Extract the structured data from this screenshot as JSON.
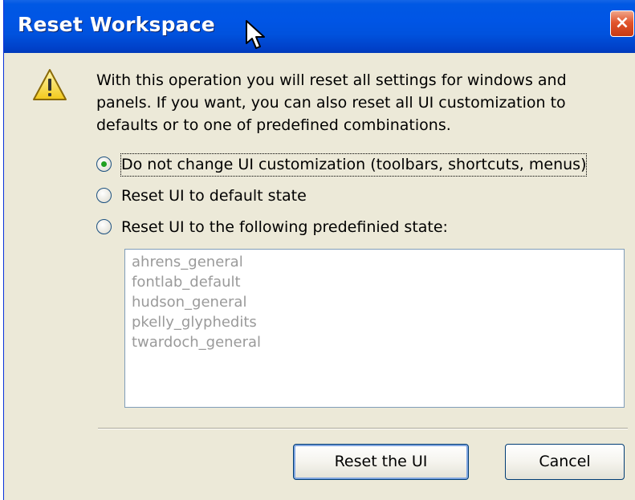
{
  "dialog": {
    "title": "Reset Workspace",
    "close_label": "×",
    "message": "With this operation you will reset all settings for windows and panels. If you want, you can also reset all UI customization to defaults or to one of predefined combinations.",
    "options": [
      {
        "label": "Do not change UI customization (toolbars, shortcuts, menus)",
        "selected": true
      },
      {
        "label": "Reset UI to default state",
        "selected": false
      },
      {
        "label": "Reset UI to the following predefinied state:",
        "selected": false
      }
    ],
    "presets": [
      "ahrens_general",
      "fontlab_default",
      "hudson_general",
      "pkelly_glyphedits",
      "twardoch_general"
    ],
    "buttons": {
      "reset": "Reset the UI",
      "cancel": "Cancel"
    }
  },
  "colors": {
    "titlebar": "#0055e5",
    "window": "#ece9d8",
    "close": "#e2552c",
    "radio_dot": "#21a121",
    "preset_text": "#9a9a9a"
  },
  "icons": {
    "warning": "warning-icon",
    "close": "close-icon",
    "cursor": "mouse-cursor-icon"
  }
}
